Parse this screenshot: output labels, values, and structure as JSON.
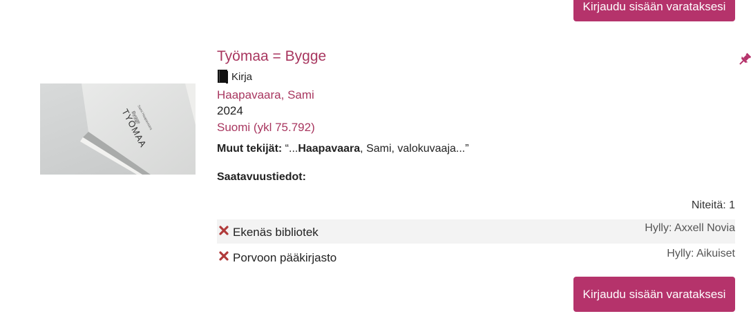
{
  "top_button": {
    "label": "Kirjaudu sisään varataksesi"
  },
  "record": {
    "title": "Työmaa = Bygge",
    "format": "Kirja",
    "format_icon": "book-icon",
    "author": "Haapavaara, Sami",
    "year": "2024",
    "classification": "Suomi (ykl 75.792)",
    "contributors_label": "Muut tekijät:",
    "contributors_prefix": " “...",
    "contributors_match": "Haapavaara",
    "contributors_suffix": ", Sami, valokuvaaja...”",
    "availability_heading": "Saatavuustiedot:",
    "copies": "Niteitä: 1",
    "cover_text": {
      "title": "TYÖMAA",
      "subtitle": "Bygge",
      "author": "Sami Haapavaara"
    }
  },
  "holdings": [
    {
      "library": "Ekenäs bibliotek",
      "shelf": "Hylly: Axxell Novia",
      "status_icon": "unavailable-x-icon"
    },
    {
      "library": "Porvoon pääkirjasto",
      "shelf": "Hylly: Aikuiset",
      "status_icon": "unavailable-x-icon"
    }
  ],
  "bottom_button": {
    "label": "Kirjaudu sisään varataksesi"
  },
  "colors": {
    "accent": "#b5336b",
    "link": "#a8365f",
    "unavailable": "#b03a3a"
  }
}
